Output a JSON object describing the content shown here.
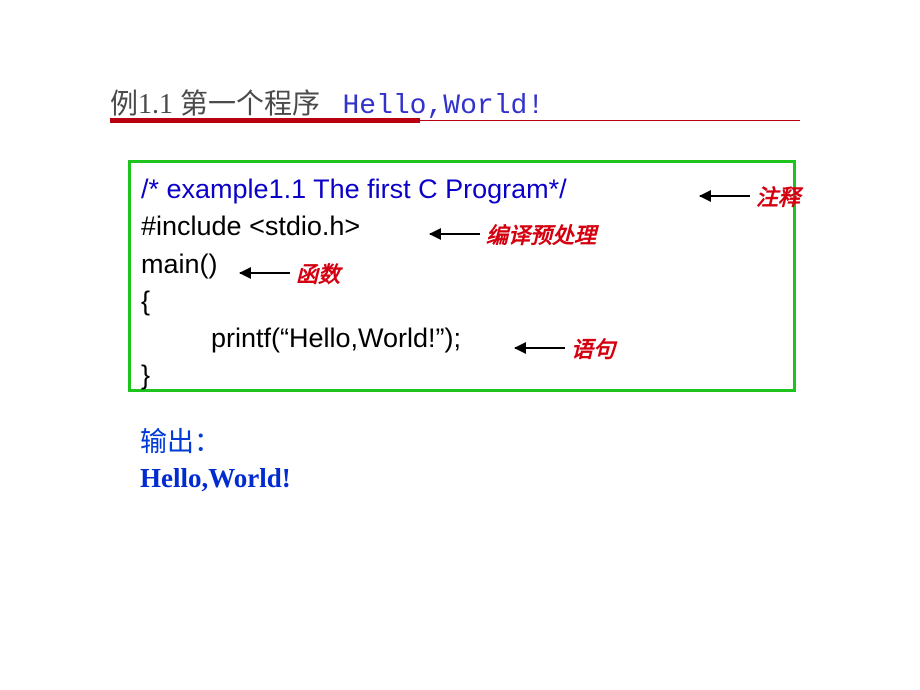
{
  "title": {
    "prefix": "例1.1   第一个程序",
    "suffix": "Hello,World!"
  },
  "code": {
    "line1": "/* example1.1   The  first  C  Program*/",
    "line2": "#include <stdio.h>",
    "line3": "main()",
    "line4": "{",
    "line5_indent": "",
    "line5": "printf(“Hello,World!”);",
    "line6": "}"
  },
  "annotations": {
    "comment": "注释",
    "preprocess": "编译预处理",
    "function": "函数",
    "statement": "语句"
  },
  "output": {
    "label": "输出：",
    "value": "Hello,World!"
  }
}
